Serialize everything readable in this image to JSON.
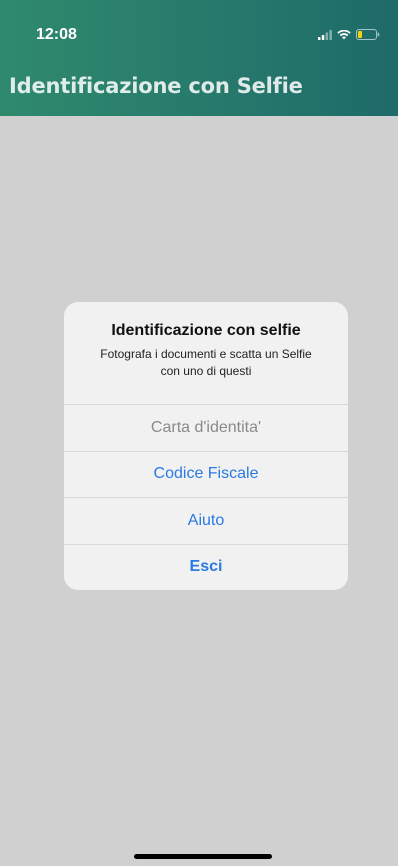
{
  "status_bar": {
    "time": "12:08",
    "icons": [
      "signal-icon",
      "wifi-icon",
      "battery-icon"
    ]
  },
  "header": {
    "title": "Identificazione con Selfie"
  },
  "alert": {
    "title": "Identificazione con selfie",
    "message": "Fotografa i documenti e scatta un Selfie con uno di questi",
    "actions": [
      {
        "label": "Carta d'identita'",
        "state": "disabled"
      },
      {
        "label": "Codice Fiscale",
        "state": "default"
      },
      {
        "label": "Aiuto",
        "state": "default"
      },
      {
        "label": "Esci",
        "state": "bold"
      }
    ]
  },
  "colors": {
    "header_start": "#2f8a6d",
    "header_end": "#1e6a6a",
    "action_blue": "#2a7ae2",
    "disabled_gray": "#8a8a8a",
    "battery_yellow": "#f5d20f"
  }
}
